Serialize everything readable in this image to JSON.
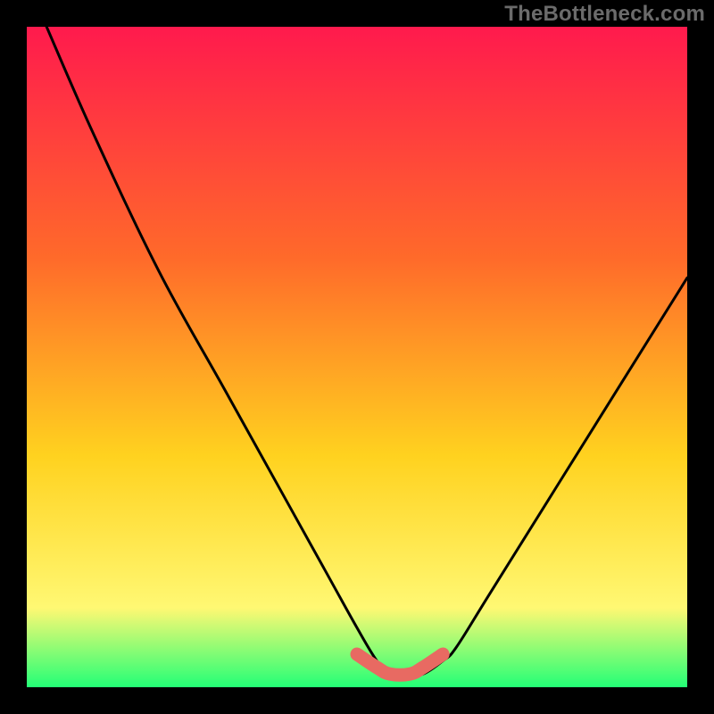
{
  "watermark": "TheBottleneck.com",
  "colors": {
    "frame": "#000000",
    "gradient_top": "#ff1a4d",
    "gradient_mid1": "#ff6a2a",
    "gradient_mid2": "#ffd21f",
    "gradient_mid3": "#fff873",
    "gradient_bottom": "#23ff76",
    "curve": "#000000",
    "band": "#e86a62"
  },
  "chart_data": {
    "type": "line",
    "title": "",
    "xlabel": "",
    "ylabel": "",
    "xlim": [
      0,
      100
    ],
    "ylim": [
      0,
      100
    ],
    "grid": false,
    "legend": false,
    "annotations": [],
    "tick_labels": {
      "x": [],
      "y": []
    },
    "series": [
      {
        "name": "bottleneck-curve",
        "x": [
          3,
          10,
          20,
          30,
          40,
          45,
          50,
          53,
          55,
          58,
          60,
          63,
          65,
          70,
          80,
          90,
          100
        ],
        "y": [
          100,
          84,
          63,
          45,
          27,
          18,
          9,
          4,
          2,
          2,
          2,
          4,
          6,
          14,
          30,
          46,
          62
        ]
      }
    ],
    "highlight_band": {
      "name": "optimal-range",
      "x": [
        50,
        53,
        55,
        58,
        60,
        63
      ],
      "y": [
        5,
        3,
        2,
        2,
        3,
        5
      ],
      "thickness": 3
    }
  }
}
